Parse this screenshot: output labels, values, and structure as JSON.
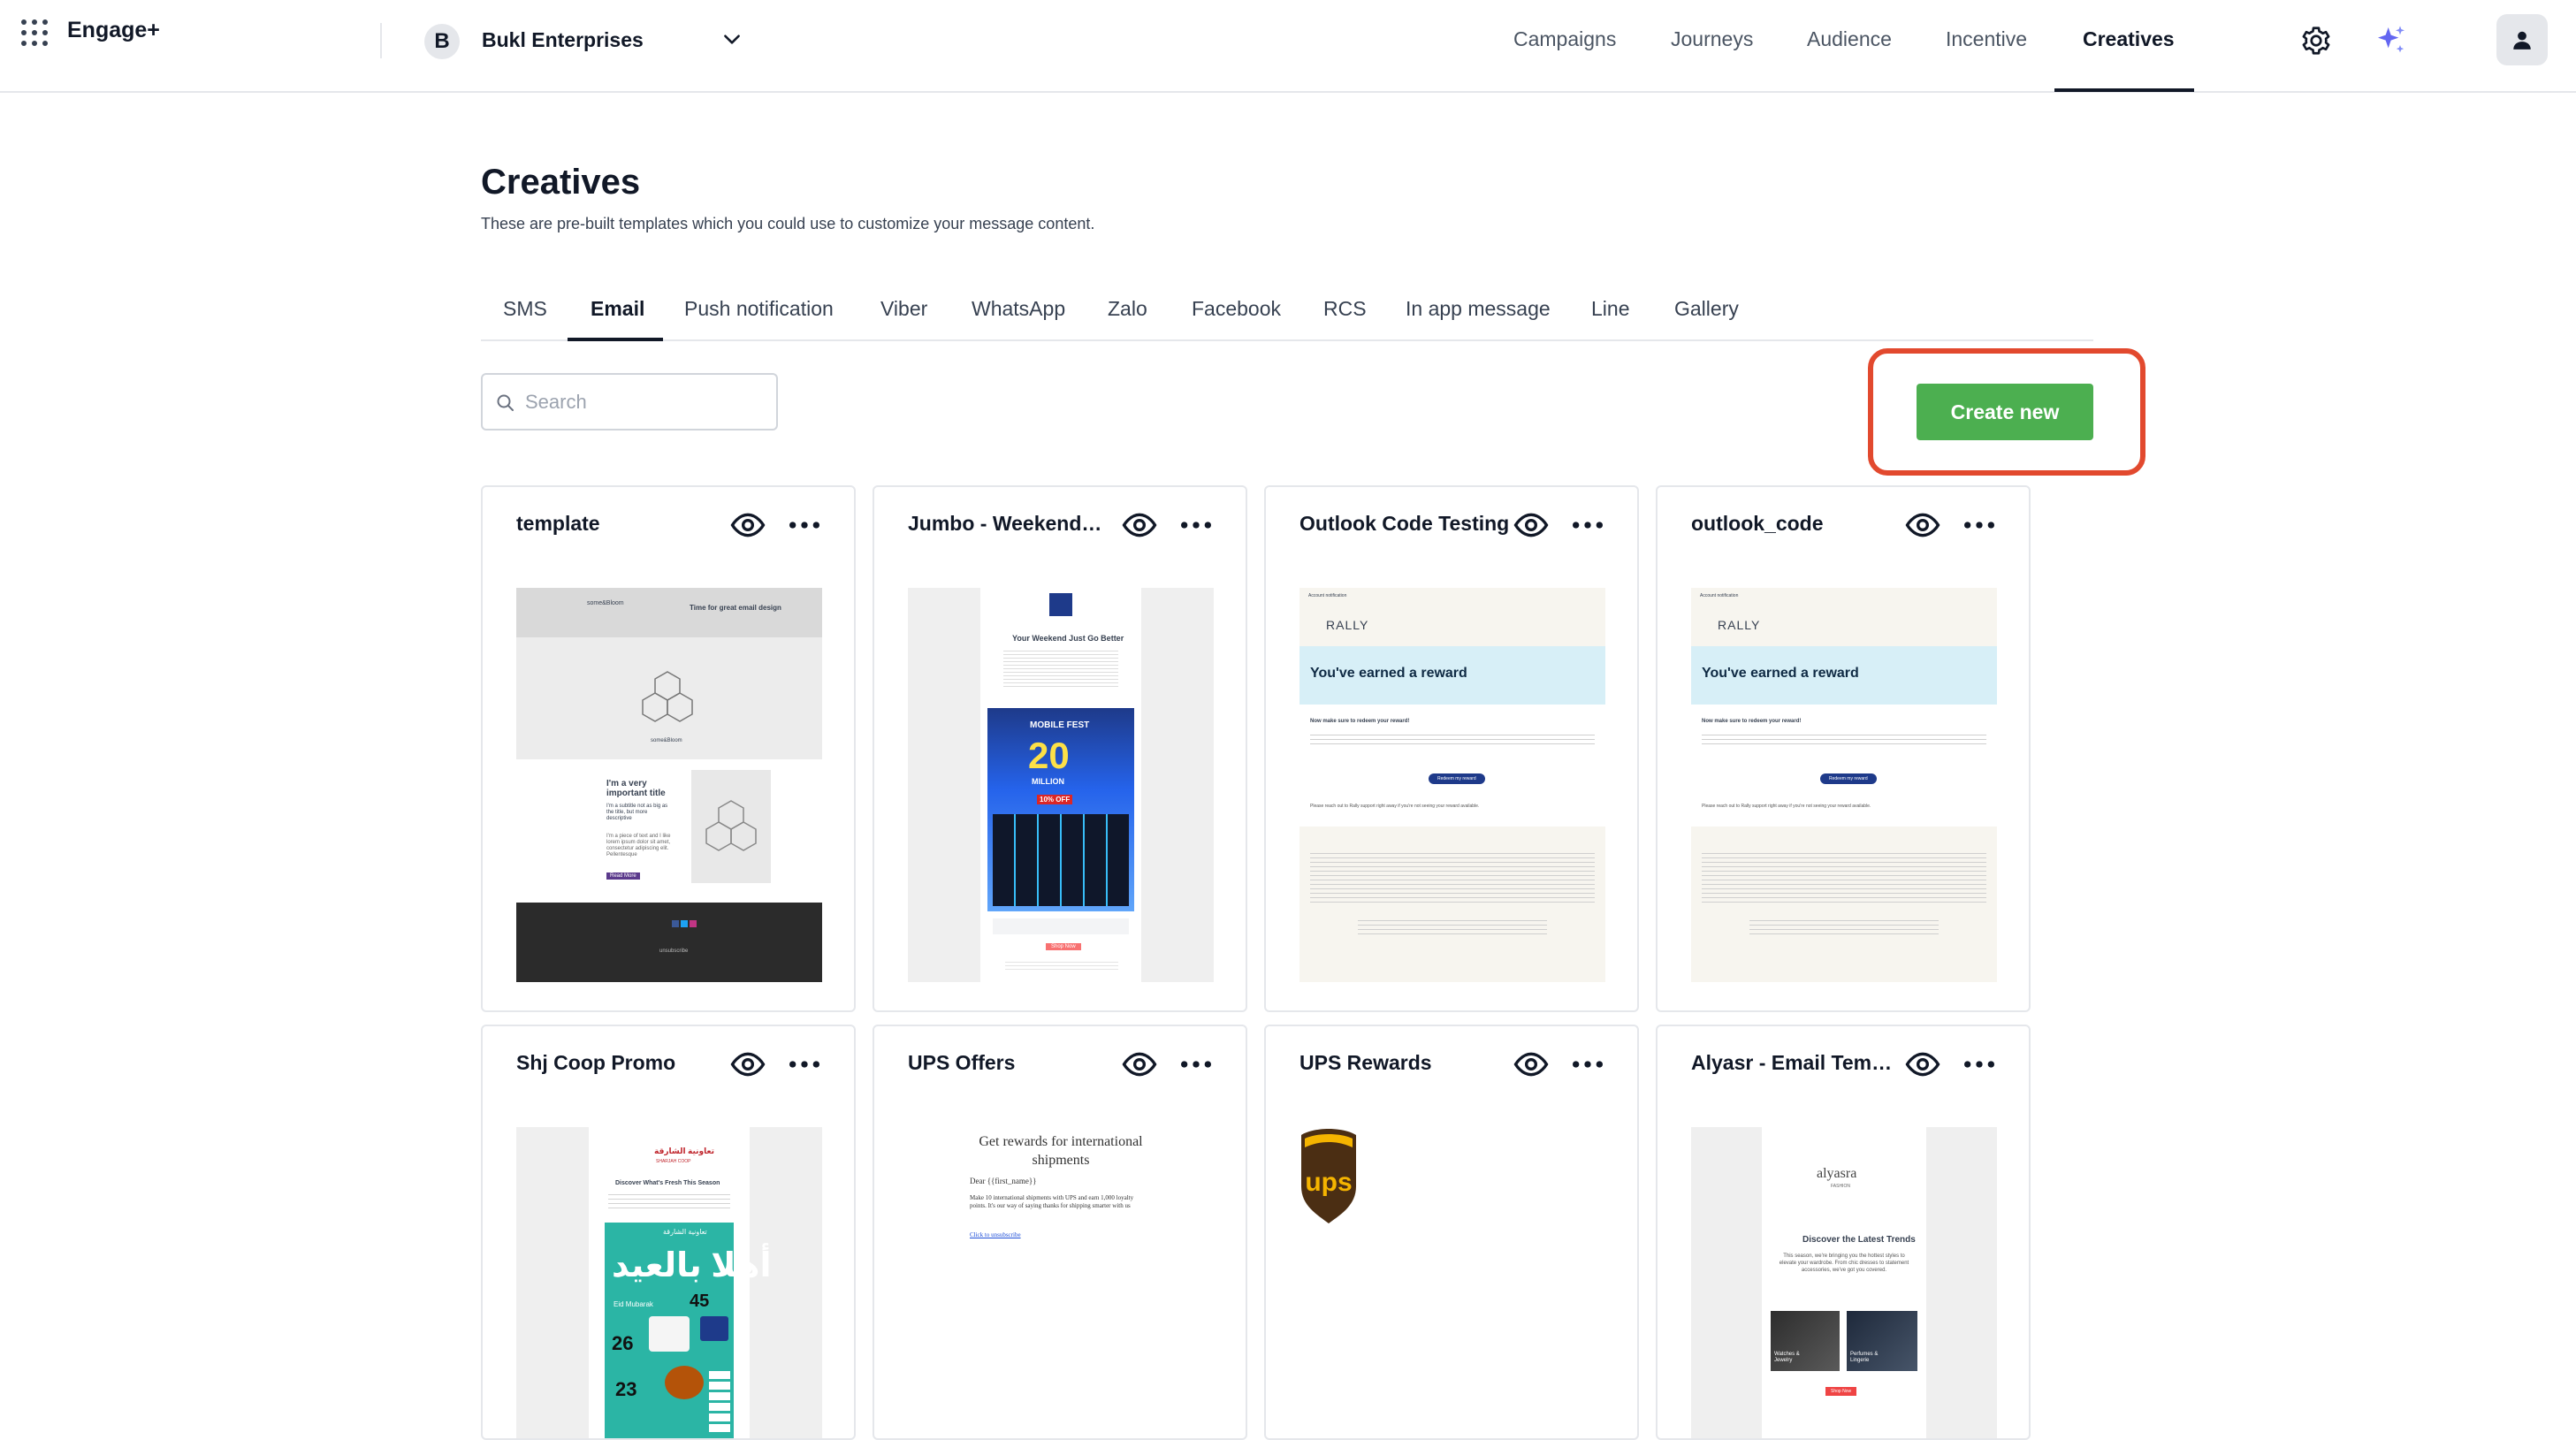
{
  "header": {
    "brand": "Engage+",
    "org_initial": "B",
    "org_name": "Bukl Enterprises",
    "nav": [
      {
        "label": "Campaigns"
      },
      {
        "label": "Journeys"
      },
      {
        "label": "Audience"
      },
      {
        "label": "Incentive"
      },
      {
        "label": "Creatives",
        "active": true
      }
    ]
  },
  "page": {
    "title": "Creatives",
    "subtitle": "These are pre-built templates which you could use to customize your message content."
  },
  "tabs": [
    {
      "label": "SMS"
    },
    {
      "label": "Email",
      "active": true
    },
    {
      "label": "Push notification"
    },
    {
      "label": "Viber"
    },
    {
      "label": "WhatsApp"
    },
    {
      "label": "Zalo"
    },
    {
      "label": "Facebook"
    },
    {
      "label": "RCS"
    },
    {
      "label": "In app message"
    },
    {
      "label": "Line"
    },
    {
      "label": "Gallery"
    }
  ],
  "search": {
    "placeholder": "Search",
    "value": ""
  },
  "create_button": {
    "label": "Create new"
  },
  "colors": {
    "accent_green": "#4caf50",
    "highlight_red": "#e2492e",
    "text_dark": "#111827"
  },
  "cards": [
    {
      "title": "template",
      "thumb": {
        "header": "Time for great email design",
        "logo_text": "some&Bloom",
        "heading": "I'm a very important title",
        "sub": "I'm a subtitle not as big as the title, but more descriptive",
        "body": "I'm a piece of text and I like lorem ipsum dolor sit amet, consectetur adipiscing elit. Pellentesque",
        "button": "Read More",
        "footer": "unsubscribe"
      }
    },
    {
      "title": "Jumbo - Weekend Fl...",
      "thumb": {
        "heading": "Your Weekend Just Go Better",
        "banner_top": "MOBILE FEST",
        "banner_big": "20",
        "banner_sub": "MILLION",
        "offer": "10% OFF",
        "cta": "Shop Now"
      }
    },
    {
      "title": "Outlook Code Testing",
      "thumb": {
        "top": "Account notification",
        "logo": "RALLY",
        "headline": "You've earned a reward",
        "line1": "Now make sure to redeem your reward!",
        "button": "Redeem my reward",
        "line2": "Please reach out to Rally support right away if you're not seeing your reward available."
      }
    },
    {
      "title": "outlook_code",
      "thumb": {
        "top": "Account notification",
        "logo": "RALLY",
        "headline": "You've earned a reward",
        "line1": "Now make sure to redeem your reward!",
        "button": "Redeem my reward",
        "line2": "Please reach out to Rally support right away if you're not seeing your reward available."
      }
    },
    {
      "title": "Shj Coop Promo",
      "thumb": {
        "arabic_logo": "تعاونية الشارقة",
        "logo": "SHARJAH COOP",
        "heading": "Discover What's Fresh This Season",
        "arabic_big": "أهلا بالعيد",
        "eid": "Eid Mubarak",
        "price1": "45",
        "price2": "26",
        "price3": "23"
      }
    },
    {
      "title": "UPS Offers",
      "thumb": {
        "heading": "Get rewards for international shipments",
        "greet": "Dear {{first_name}}",
        "body": "Make 10 international shipments with UPS and earn 1,000 loyalty points. It's our way of saying thanks for shipping smarter with us",
        "link": "Click to unsubscribe"
      }
    },
    {
      "title": "UPS Rewards",
      "thumb": {
        "logo": "ups"
      }
    },
    {
      "title": "Alyasr - Email Templ...",
      "thumb": {
        "logo": "alyasra",
        "logo_sub": "FASHION",
        "heading": "Discover the Latest Trends",
        "body": "This season, we're bringing you the hottest styles to elevate your wardrobe. From chic dresses to statement accessories, we've got you covered.",
        "tile1": "Watches & Jewelry",
        "tile2": "Perfumes & Lingerie",
        "cta": "Shop Now"
      }
    }
  ]
}
